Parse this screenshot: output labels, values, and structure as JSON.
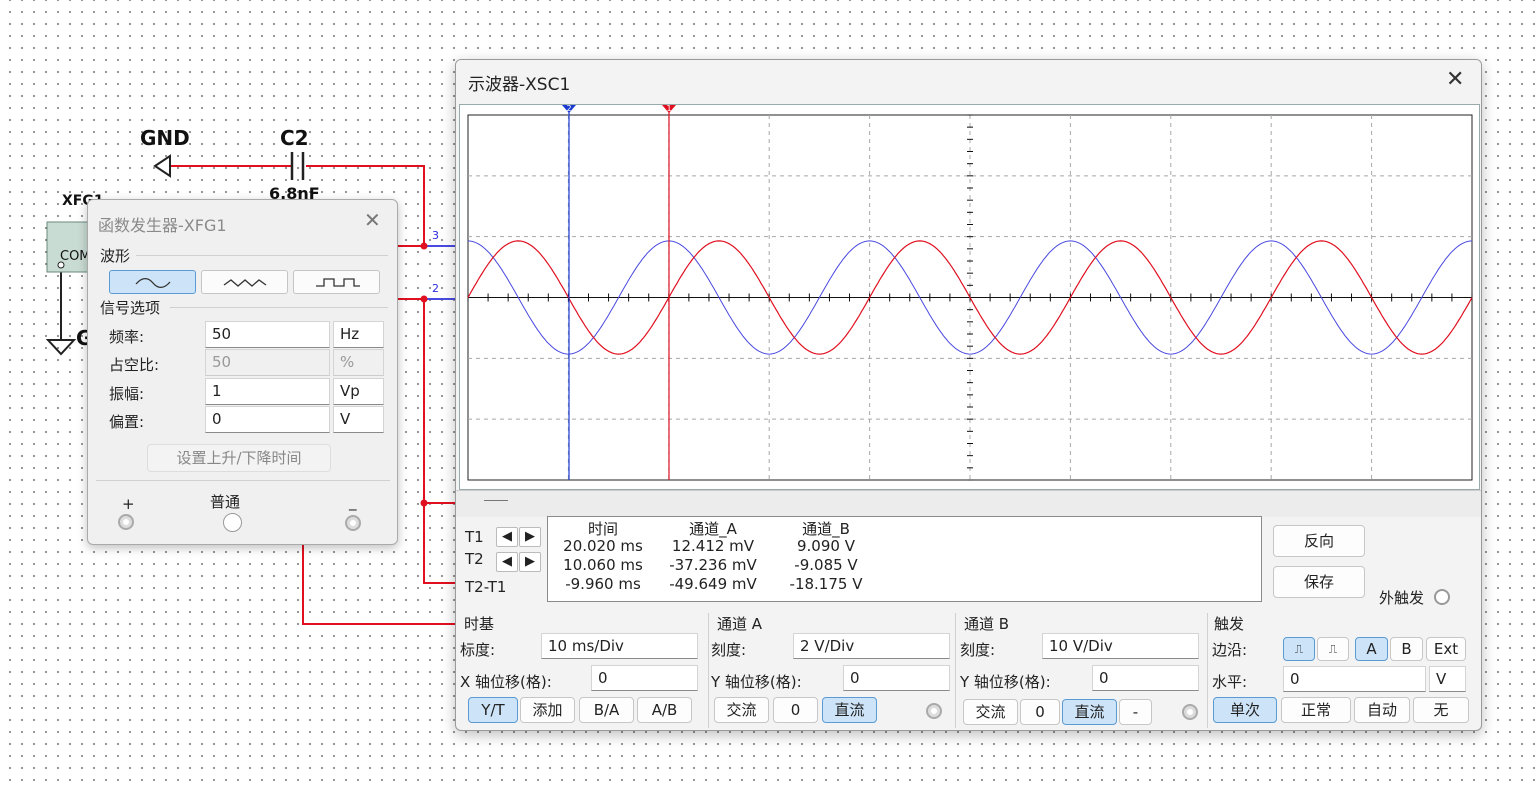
{
  "schematic": {
    "gnd_label": "GND",
    "cap_label": "C2",
    "cap_value": "6.8nF",
    "xfg_label": "XFG1",
    "com_label": "COM",
    "gnd_partial": "G",
    "ch3_label": "3",
    "ch2_label": "2"
  },
  "scope": {
    "title": "示波器-XSC1",
    "close": "✕",
    "readout": {
      "headers": [
        "时间",
        "通道_A",
        "通道_B"
      ],
      "row_labels": [
        "T1",
        "T2",
        "T2-T1"
      ],
      "rows": [
        [
          "20.020 ms",
          "12.412 mV",
          "9.090 V"
        ],
        [
          "10.060 ms",
          "-37.236 mV",
          "-9.085 V"
        ],
        [
          "-9.960 ms",
          "-49.649 mV",
          "-18.175 V"
        ]
      ]
    },
    "reverse_label": "反向",
    "save_label": "保存",
    "ext_trigger_label": "外触发",
    "timebase": {
      "title": "时基",
      "scale_label": "标度:",
      "scale_value": "10 ms/Div",
      "xpos_label": "X 轴位移(格):",
      "xpos_value": "0",
      "buttons": [
        "Y/T",
        "添加",
        "B/A",
        "A/B"
      ]
    },
    "channel_a": {
      "title": "通道 A",
      "scale_label": "刻度:",
      "scale_value": "2  V/Div",
      "ypos_label": "Y 轴位移(格):",
      "ypos_value": "0",
      "buttons": [
        "交流",
        "0",
        "直流"
      ]
    },
    "channel_b": {
      "title": "通道 B",
      "scale_label": "刻度:",
      "scale_value": "10  V/Div",
      "ypos_label": "Y 轴位移(格):",
      "ypos_value": "0",
      "buttons": [
        "交流",
        "0",
        "直流",
        "-"
      ]
    },
    "trigger": {
      "title": "触发",
      "edge_label": "边沿:",
      "edge_buttons": [
        "A",
        "B",
        "Ext"
      ],
      "level_label": "水平:",
      "level_value": "0",
      "level_unit": "V",
      "mode_buttons": [
        "单次",
        "正常",
        "自动",
        "无"
      ]
    },
    "colors": {
      "channel_a": "#e01020",
      "channel_b": "#4a4ae0",
      "cursor_1": "#1a3ad0",
      "cursor_2": "#e01020"
    },
    "cursor_markers": [
      "2",
      "1"
    ]
  },
  "fg": {
    "title": "函数发生器-XFG1",
    "close": "✕",
    "waveform_label": "波形",
    "waveforms": [
      "sine-icon",
      "triangle-icon",
      "square-icon"
    ],
    "signal_options_label": "信号选项",
    "params": [
      {
        "label": "频率:",
        "value": "50",
        "unit": "Hz"
      },
      {
        "label": "占空比:",
        "value": "50",
        "unit": "%"
      },
      {
        "label": "振幅:",
        "value": "1",
        "unit": "Vp"
      },
      {
        "label": "偏置:",
        "value": "0",
        "unit": "V"
      }
    ],
    "rise_fall_button": "设置上升/下降时间",
    "plus_label": "+",
    "common_label": "普通",
    "minus_label": "_"
  },
  "chart_data": {
    "type": "line",
    "xlabel": "",
    "ylabel": "",
    "x_divisions": 10,
    "y_divisions": 6,
    "time_per_div_ms": 10,
    "series": [
      {
        "color": "#e01020",
        "waveform": "sine",
        "frequency_hz": 50,
        "amplitude_div": 0.93,
        "phase_deg": 0
      },
      {
        "color": "#4a4ae0",
        "waveform": "sine",
        "frequency_hz": 50,
        "amplitude_div": 0.93,
        "phase_deg": 90
      }
    ],
    "cursors_ms": [
      10.06,
      20.02
    ]
  }
}
